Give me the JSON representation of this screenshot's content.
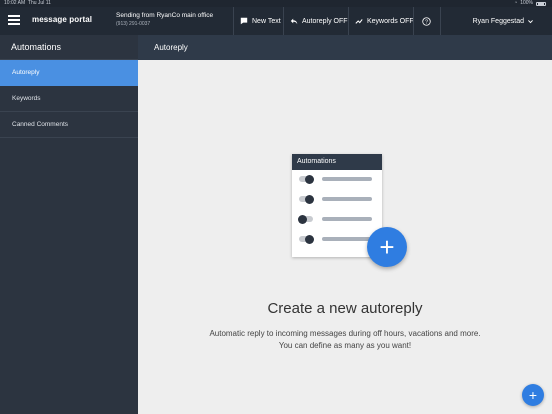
{
  "status_bar": {
    "time": "10:02 AM",
    "date": "Thu Jul 11",
    "battery": "100%"
  },
  "app": {
    "logo": "message portal"
  },
  "sending": {
    "line1": "Sending from RyanCo main office",
    "phone": "(913) 291-0037"
  },
  "toolbar": {
    "new_text": "New Text",
    "autoreply": "Autoreply OFF",
    "keywords": "Keywords OFF",
    "help_icon": "question-circle-icon",
    "user_name": "Ryan Feggestad"
  },
  "sidebar": {
    "title": "Automations",
    "items": [
      {
        "label": "Autoreply",
        "active": true
      },
      {
        "label": "Keywords",
        "active": false
      },
      {
        "label": "Canned Comments",
        "active": false
      }
    ]
  },
  "main": {
    "header": "Autoreply",
    "illustration": {
      "title": "Automations",
      "toggles": [
        "on",
        "on",
        "off",
        "on"
      ]
    },
    "empty_title": "Create a new autoreply",
    "empty_desc": "Automatic reply to incoming messages during off hours, vacations and more. You can define as many as you want!",
    "add_icon": "plus-icon"
  },
  "colors": {
    "accent": "#4a90e2",
    "fab": "#2f7de1",
    "sidebar": "#2c3440",
    "topbar": "#222a35"
  }
}
